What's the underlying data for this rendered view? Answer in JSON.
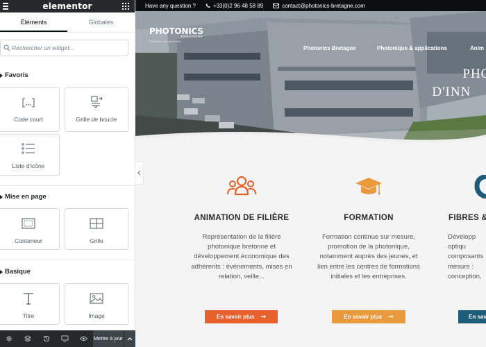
{
  "editor": {
    "brand": "elementor",
    "tabs": [
      {
        "label": "Éléments",
        "active": true
      },
      {
        "label": "Globales",
        "active": false
      }
    ],
    "search": {
      "placeholder": "Rechercher un widget..."
    },
    "categories": [
      {
        "title": "Favoris",
        "widgets": [
          {
            "label": "Code court",
            "icon": "shortcode-icon"
          },
          {
            "label": "Grille de boucle",
            "icon": "loop-grid-icon"
          },
          {
            "label": "Liste d'icône",
            "icon": "icon-list-icon"
          }
        ]
      },
      {
        "title": "Mise en page",
        "widgets": [
          {
            "label": "Conteneur",
            "icon": "container-icon"
          },
          {
            "label": "Grille",
            "icon": "grid-icon"
          }
        ]
      },
      {
        "title": "Basique",
        "widgets": [
          {
            "label": "Titre",
            "icon": "heading-icon"
          },
          {
            "label": "Image",
            "icon": "image-icon"
          }
        ]
      }
    ],
    "footer": {
      "update_label": "Mettre à jour"
    }
  },
  "site": {
    "topbar": {
      "question": "Have any question ?",
      "phone": "+33(0)2 96 48 58 89",
      "email": "contact@photonics-bretagne.com"
    },
    "logo": {
      "main": "PHOTONICS",
      "sub": "BRETAGNE",
      "tagline": "Photonics innovation Hub"
    },
    "nav": [
      "Photonics Bretagne",
      "Photonique & applications",
      "Anim"
    ],
    "hero_title": [
      "PHOT",
      "D'INN"
    ],
    "features": [
      {
        "title": "ANIMATION DE FILIÈRE",
        "text": "Représentation de la filière photonique bretonne et développement économique des adhérents : événements, mises en relation, veille...",
        "button": "En savoir plus",
        "color": "#e8602c",
        "icon": "people-group-icon"
      },
      {
        "title": "FORMATION",
        "text": "Formation continue sur mesure, promotion de la photonique, notamment auprès des jeunes, et lien entre les centres de formations initiales et les entreprises.",
        "button": "En savoir plus",
        "color": "#e89a3c",
        "icon": "graduation-cap-icon"
      },
      {
        "title": "FIBRES &",
        "text": "Développ optiqu composants mesure : conception,",
        "button": "En sav",
        "color": "#1f5c7a",
        "icon": "fiber-icon"
      }
    ]
  },
  "colors": {
    "editor_dark": "#26292c",
    "accent_orange": "#e8602c",
    "accent_amber": "#e89a3c",
    "accent_navy": "#1f5c7a"
  }
}
